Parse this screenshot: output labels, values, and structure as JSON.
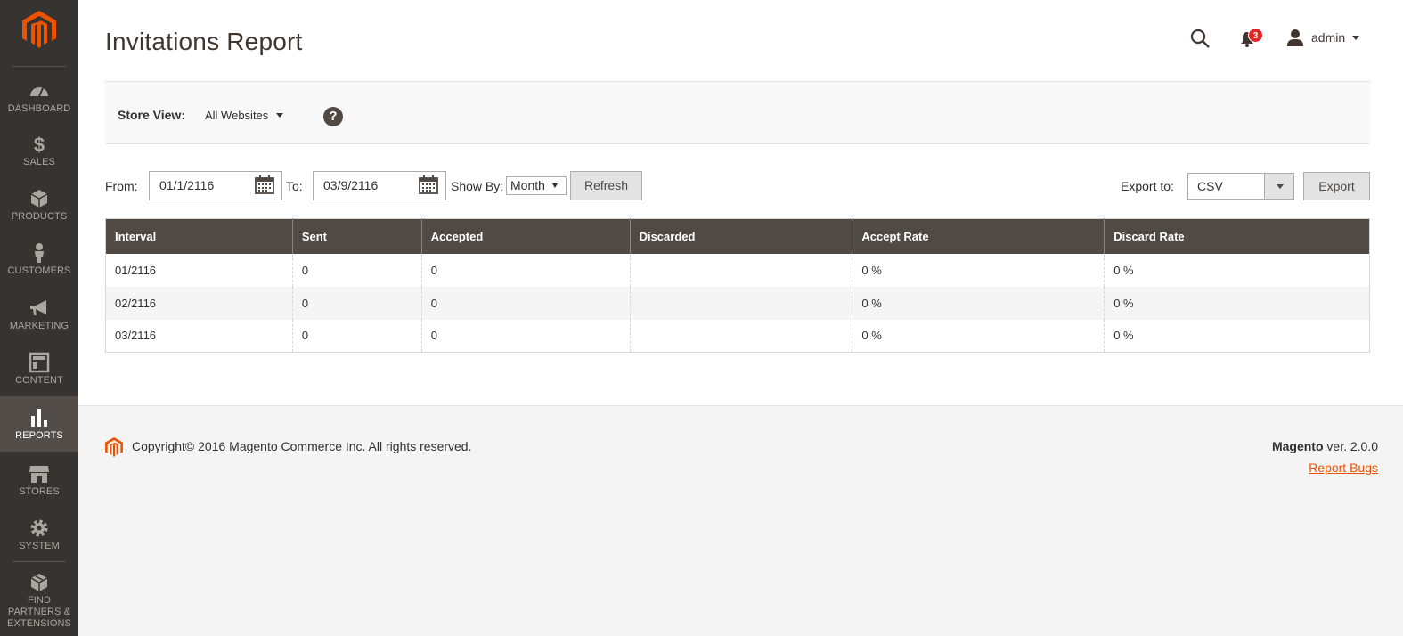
{
  "colors": {
    "accent": "#eb5202",
    "sidebar_bg": "#373330",
    "header_bg": "#514943",
    "badge": "#e22626"
  },
  "sidebar": {
    "items": [
      {
        "label": "DASHBOARD",
        "icon": "dashboard-icon"
      },
      {
        "label": "SALES",
        "icon": "dollar-icon"
      },
      {
        "label": "PRODUCTS",
        "icon": "cube-icon"
      },
      {
        "label": "CUSTOMERS",
        "icon": "person-icon"
      },
      {
        "label": "MARKETING",
        "icon": "megaphone-icon"
      },
      {
        "label": "CONTENT",
        "icon": "layout-icon"
      },
      {
        "label": "REPORTS",
        "icon": "bar-chart-icon",
        "active": true
      },
      {
        "label": "STORES",
        "icon": "store-icon"
      },
      {
        "label": "SYSTEM",
        "icon": "gear-icon"
      },
      {
        "label": "FIND PARTNERS & EXTENSIONS",
        "icon": "box-icon"
      }
    ]
  },
  "header": {
    "title": "Invitations Report",
    "notification_count": "3",
    "user_name": "admin"
  },
  "store_bar": {
    "label": "Store View:",
    "selected": "All Websites"
  },
  "filters": {
    "from_label": "From:",
    "from_value": "01/1/2116",
    "to_label": "To:",
    "to_value": "03/9/2116",
    "show_by_label": "Show By:",
    "show_by_value": "Month",
    "refresh_label": "Refresh",
    "export_label": "Export to:",
    "export_value": "CSV",
    "export_button": "Export"
  },
  "table": {
    "columns": [
      "Interval",
      "Sent",
      "Accepted",
      "Discarded",
      "Accept Rate",
      "Discard Rate"
    ],
    "rows": [
      [
        "01/2116",
        "0",
        "0",
        "",
        "0 %",
        "0 %"
      ],
      [
        "02/2116",
        "0",
        "0",
        "",
        "0 %",
        "0 %"
      ],
      [
        "03/2116",
        "0",
        "0",
        "",
        "0 %",
        "0 %"
      ]
    ]
  },
  "footer": {
    "copyright": "Copyright© 2016 Magento Commerce Inc. All rights reserved.",
    "brand": "Magento",
    "version": " ver. 2.0.0",
    "report_bugs": "Report Bugs"
  }
}
